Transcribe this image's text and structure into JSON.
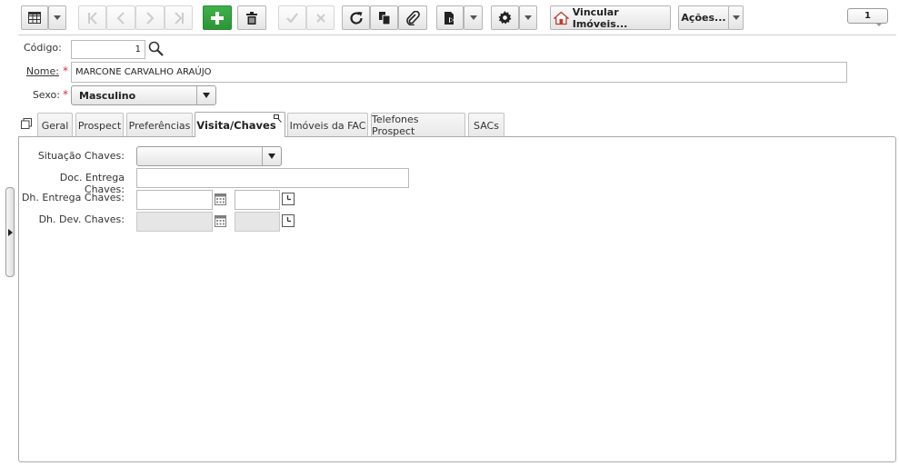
{
  "toolbar": {
    "vincular_label": "Vincular Imóveis...",
    "acoes_label": "Ações...",
    "record_count": "1"
  },
  "form": {
    "codigo_label": "Código:",
    "codigo_value": "1",
    "nome_label": "Nome:",
    "nome_value": "MARCONE CARVALHO ARAÚJO",
    "sexo_label": "Sexo:",
    "sexo_value": "Masculino",
    "required_mark": "*"
  },
  "tabs": [
    {
      "label": "Geral"
    },
    {
      "label": "Prospect"
    },
    {
      "label": "Preferências"
    },
    {
      "label": "Visita/Chaves"
    },
    {
      "label": "Imóveis da FAC"
    },
    {
      "label": "Telefones Prospect"
    },
    {
      "label": "SACs"
    }
  ],
  "panel": {
    "situacao_label": "Situação Chaves:",
    "situacao_value": "",
    "doc_entrega_label": "Doc. Entrega Chaves:",
    "doc_entrega_value": "",
    "dh_entrega_label": "Dh. Entrega Chaves:",
    "dh_entrega_date": "",
    "dh_entrega_time": "",
    "dh_dev_label": "Dh. Dev. Chaves:",
    "dh_dev_date": "",
    "dh_dev_time": ""
  },
  "colors": {
    "green_button": "#2c9436",
    "required": "#dd3333",
    "tab_border": "#a9a9a9"
  }
}
